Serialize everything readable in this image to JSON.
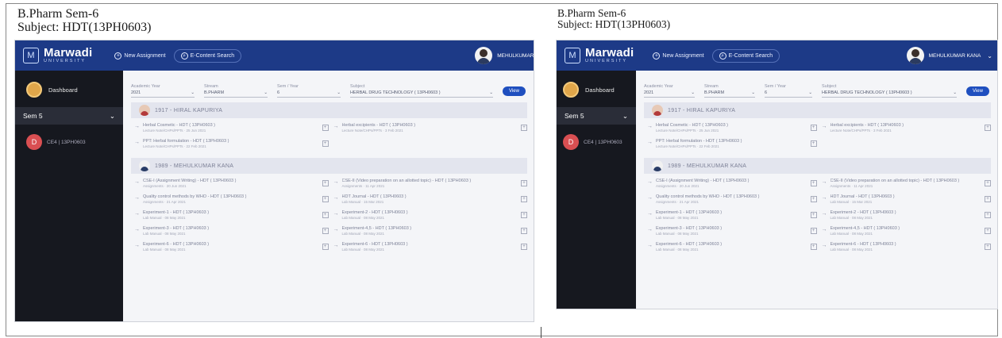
{
  "heading": {
    "line1": "B.Pharm Sem-6",
    "line2": "Subject: HDT(13PH0603)"
  },
  "app": {
    "brand": "Marwadi",
    "brand_sub": "UNIVERSITY",
    "new_assignment": "New Assignment",
    "econtent_search": "E-Content Search",
    "user_name": "MEHULKUMAR KANA",
    "dashboard": "Dashboard",
    "sem": "Sem 5",
    "subject_badge": "D",
    "subject_short": "CE4 | 13PH0603"
  },
  "filters": {
    "academic_year_label": "Academic Year",
    "academic_year": "2021",
    "stream_label": "Stream",
    "stream": "B.PHARM",
    "sem_label": "Sem / Year",
    "sem": "6",
    "subject_label": "Subject",
    "subject": "HERBAL DRUG TECHNOLOGY ( 13PH0603 )",
    "view": "View"
  },
  "faculty1": "1917 - HIRAL KAPURIYA",
  "faculty2": "1989 - MEHULKUMAR KANA",
  "items_f1": [
    {
      "title": "Herbal Cosmetic - HDT ( 13PH0603 )",
      "meta": "Lecture Note/CHPs/PPTs · 25 Jun 2021"
    },
    {
      "title": "Herbal excipients - HDT ( 13PH0603 )",
      "meta": "Lecture Note/CHPs/PPTs · 3 Feb 2021"
    },
    {
      "title": "PPT: Herbal formulation - HDT ( 13PH0603 )",
      "meta": "Lecture Note/CHPs/PPTs · 22 Feb 2021"
    }
  ],
  "items_f2": [
    {
      "title": "CSE-I (Assignment Writing) - HDT ( 13PH0603 )",
      "meta": "Assignments · 20 Jun 2021"
    },
    {
      "title": "CSE-II (Video preparation on an allotted topic) - HDT ( 13PH0603 )",
      "meta": "Assignments · 11 Apr 2021"
    },
    {
      "title": "Quality control methods by WHO - HDT ( 13PH0603 )",
      "meta": "Assignments · 21 Apr 2021"
    },
    {
      "title": "HDT Journal - HDT ( 13PH0603 )",
      "meta": "Lab Manual · 15 Mar 2021"
    },
    {
      "title": "Experiment-1 - HDT ( 13PH0603 )",
      "meta": "Lab Manual · 08 May 2021"
    },
    {
      "title": "Experiment-2 - HDT ( 13PH0603 )",
      "meta": "Lab Manual · 08 May 2021"
    },
    {
      "title": "Experiment-3 - HDT ( 13PH0603 )",
      "meta": "Lab Manual · 08 May 2021"
    },
    {
      "title": "Experiment-4,5 - HDT ( 13PH0603 )",
      "meta": "Lab Manual · 08 May 2021"
    },
    {
      "title": "Experiment-6 - HDT ( 13PH0603 )",
      "meta": "Lab Manual · 08 May 2021"
    },
    {
      "title": "Experiment-6 - HDT ( 13PH0603 )",
      "meta": "Lab Manual · 08 May 2021"
    }
  ],
  "colors": {
    "topbar": "#1d3a87",
    "sidebar": "#16181f",
    "accent": "#1f4fbf"
  }
}
